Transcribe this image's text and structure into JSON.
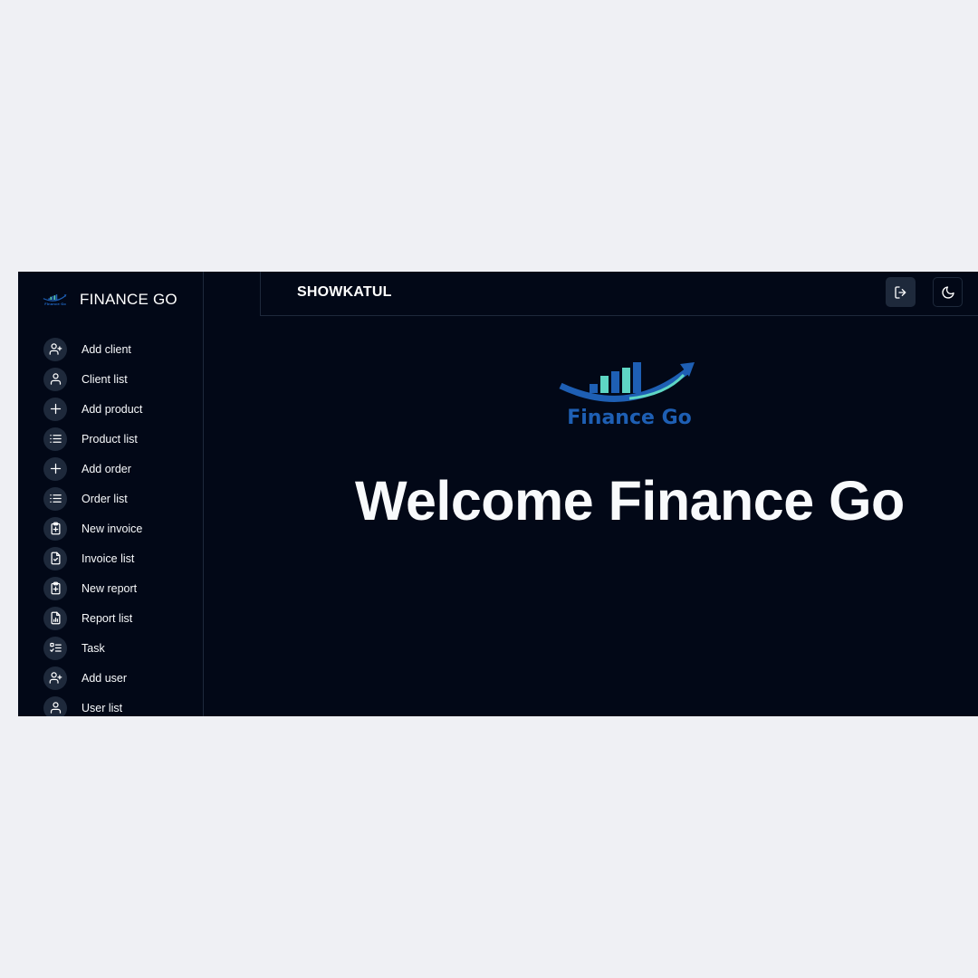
{
  "brand": {
    "name": "FINANCE GO",
    "logo_text": "Finance Go"
  },
  "sidebar": {
    "items": [
      {
        "label": "Add client",
        "icon": "user-plus-icon"
      },
      {
        "label": "Client list",
        "icon": "user-icon"
      },
      {
        "label": "Add product",
        "icon": "plus-icon"
      },
      {
        "label": "Product list",
        "icon": "list-icon"
      },
      {
        "label": "Add order",
        "icon": "plus-icon"
      },
      {
        "label": "Order list",
        "icon": "list-icon"
      },
      {
        "label": "New invoice",
        "icon": "clipboard-plus-icon"
      },
      {
        "label": "Invoice list",
        "icon": "file-check-icon"
      },
      {
        "label": "New report",
        "icon": "clipboard-plus-icon"
      },
      {
        "label": "Report list",
        "icon": "file-chart-icon"
      },
      {
        "label": "Task",
        "icon": "list-checks-icon"
      },
      {
        "label": "Add user",
        "icon": "user-plus-icon"
      },
      {
        "label": "User list",
        "icon": "user-icon"
      }
    ]
  },
  "header": {
    "username": "SHOWKATUL",
    "logout_icon": "log-out-icon",
    "theme_icon": "moon-icon"
  },
  "main": {
    "welcome": "Welcome Finance Go"
  },
  "colors": {
    "page_background": "#eff0f4",
    "app_background": "#020817",
    "border": "#1e293b",
    "icon_circle": "#1e293b",
    "logo_blue": "#1e5fb4",
    "logo_teal": "#5ed6c4"
  }
}
